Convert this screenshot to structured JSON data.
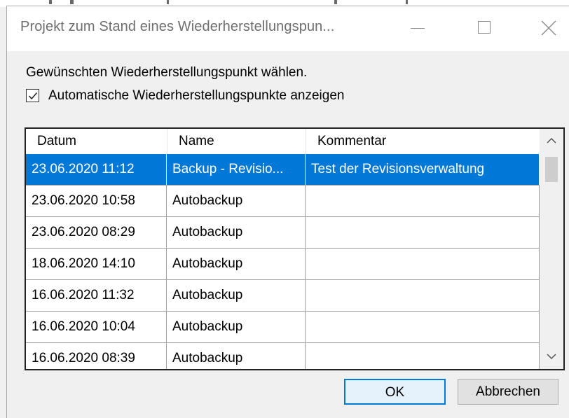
{
  "window": {
    "title": "Projekt zum Stand eines Wiederherstellungspun...",
    "minimize_icon": "minimize-icon",
    "maximize_icon": "maximize-icon",
    "close_icon": "close-icon"
  },
  "prompt": "Gewünschten Wiederherstellungspunkt wählen.",
  "checkbox": {
    "label": "Automatische Wiederherstellungspunkte anzeigen",
    "checked": true
  },
  "table": {
    "columns": [
      "Datum",
      "Name",
      "Kommentar"
    ],
    "rows": [
      {
        "datum": "23.06.2020 11:12",
        "name": "Backup - Revisio...",
        "kommentar": "Test der Revisionsverwaltung",
        "selected": true
      },
      {
        "datum": "23.06.2020 10:58",
        "name": "Autobackup",
        "kommentar": ""
      },
      {
        "datum": "23.06.2020 08:29",
        "name": "Autobackup",
        "kommentar": ""
      },
      {
        "datum": "18.06.2020 14:10",
        "name": "Autobackup",
        "kommentar": ""
      },
      {
        "datum": "16.06.2020 11:32",
        "name": "Autobackup",
        "kommentar": ""
      },
      {
        "datum": "16.06.2020 10:04",
        "name": "Autobackup",
        "kommentar": ""
      },
      {
        "datum": "16.06.2020 08:39",
        "name": "Autobackup",
        "kommentar": ""
      }
    ]
  },
  "buttons": {
    "ok": "OK",
    "cancel": "Abbrechen"
  },
  "colors": {
    "selection": "#0078d7",
    "default_button_border": "#0078d7"
  }
}
